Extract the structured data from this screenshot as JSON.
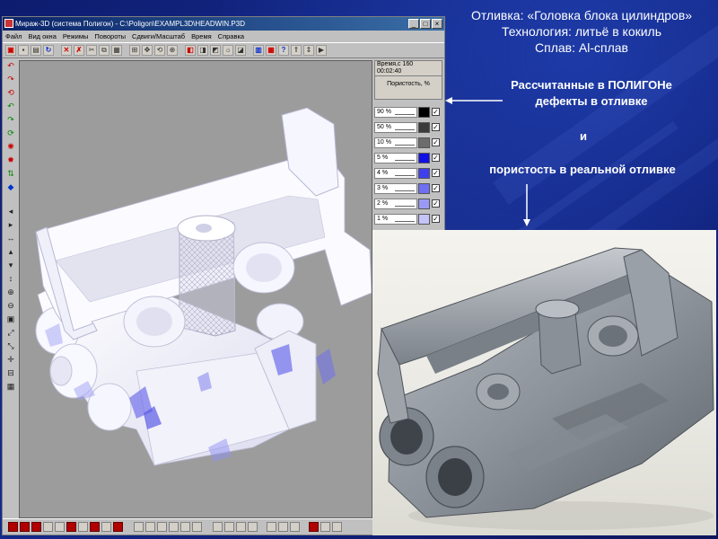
{
  "window": {
    "title": "Мираж-3D (система Полигон) - C:\\Poligon\\EXAMPL3D\\HEADWIN.P3D",
    "menu": [
      "Файл",
      "Вид окна",
      "Режимы",
      "Повороты",
      "Сдвиги/Масштаб",
      "Время",
      "Справка"
    ],
    "toolbar_icons": [
      "open-icon",
      "save-icon",
      "print-icon",
      "refresh-icon",
      "close-x-icon",
      "delete-icon",
      "cut-icon",
      "copy-icon",
      "paste-icon",
      "grid-icon",
      "move-icon",
      "rotate-icon",
      "zoom-icon",
      "view3d-icon",
      "slice-icon",
      "shade-icon",
      "light-icon",
      "color-icon",
      "bar-chart-icon",
      "palette-icon",
      "help-icon",
      "time-up-icon",
      "time-down-icon",
      "play-icon"
    ],
    "time_label": "Время,с 160",
    "time_value": "00:02:40",
    "porosity_label": "Пористость, %",
    "legend": [
      {
        "label": "90 %",
        "color": "#000000",
        "checked": true
      },
      {
        "label": "50 %",
        "color": "#3a3a3a",
        "checked": true
      },
      {
        "label": "10 %",
        "color": "#6c6c6c",
        "checked": true
      },
      {
        "label": "5 %",
        "color": "#1010e6",
        "checked": true
      },
      {
        "label": "4 %",
        "color": "#3f3ff0",
        "checked": true
      },
      {
        "label": "3 %",
        "color": "#6f6ff4",
        "checked": true
      },
      {
        "label": "2 %",
        "color": "#9a9af6",
        "checked": true
      },
      {
        "label": "1 %",
        "color": "#c4c4fb",
        "checked": true
      }
    ]
  },
  "slide": {
    "heading_lines": [
      "Отливка: «Головка блока цилиндров»",
      "Технология: литьё в кокиль",
      "Сплав: Al-сплав"
    ],
    "callout1_line1": "Рассчитанные в ПОЛИГОНе",
    "callout1_line2": "дефекты в отливке",
    "callout_and": "и",
    "callout2": "пористость в реальной отливке"
  },
  "colors": {
    "background": "#11238a",
    "viewport": "#9c9c9c",
    "model": "#ececf8",
    "defect": "#7070ee",
    "photo_metal": "#8e9399"
  }
}
